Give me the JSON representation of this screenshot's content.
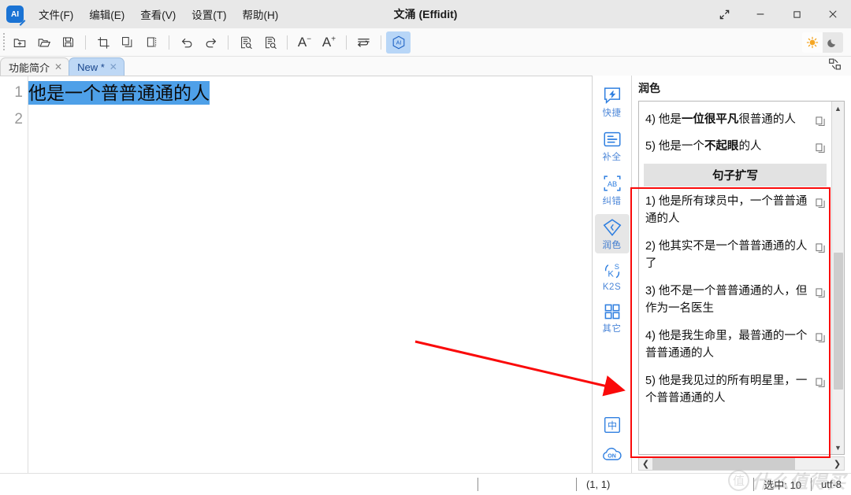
{
  "window": {
    "title": "文涌 (Effidit)",
    "logo_text": "AI",
    "controls": [
      {
        "name": "restore-expand-button",
        "glyph": "⤢"
      },
      {
        "name": "minimize-button",
        "glyph": "—"
      },
      {
        "name": "maximize-button",
        "glyph": "☐"
      },
      {
        "name": "close-button",
        "glyph": "✕"
      }
    ]
  },
  "menubar": {
    "items": [
      {
        "label": "文件(F)",
        "name": "menu-file"
      },
      {
        "label": "编辑(E)",
        "name": "menu-edit"
      },
      {
        "label": "查看(V)",
        "name": "menu-view"
      },
      {
        "label": "设置(T)",
        "name": "menu-settings"
      },
      {
        "label": "帮助(H)",
        "name": "menu-help"
      }
    ]
  },
  "toolbar": {
    "buttons": [
      {
        "name": "new-file-icon",
        "title": "新建"
      },
      {
        "name": "open-folder-icon",
        "title": "打开"
      },
      {
        "name": "save-icon",
        "title": "保存"
      },
      {
        "name": "cut-icon",
        "title": "剪切"
      },
      {
        "name": "copy-icon",
        "title": "复制"
      },
      {
        "name": "paste-icon",
        "title": "粘贴"
      },
      {
        "name": "undo-icon",
        "title": "撤销"
      },
      {
        "name": "redo-icon",
        "title": "重做"
      },
      {
        "name": "find-icon",
        "title": "查找"
      },
      {
        "name": "replace-icon",
        "title": "替换"
      },
      {
        "name": "font-decrease-icon",
        "label": "A−"
      },
      {
        "name": "font-increase-icon",
        "label": "A+"
      },
      {
        "name": "wrap-lines-icon",
        "title": "自动换行"
      },
      {
        "name": "ai-assistant-icon",
        "title": "AI",
        "active": true
      }
    ],
    "theme": {
      "light_icon": "sun-icon",
      "dark_icon": "moon-icon",
      "accent": "#f5a623"
    }
  },
  "tabs": {
    "items": [
      {
        "label": "功能简介",
        "close": "✕",
        "active": false,
        "name": "tab-intro"
      },
      {
        "label": "New *",
        "close": "✕",
        "active": true,
        "name": "tab-new"
      }
    ],
    "right_icon": "split-view-icon"
  },
  "editor": {
    "line_numbers": [
      "1",
      "2"
    ],
    "line1_text": "他是一个普普通通的人",
    "line2_text": ""
  },
  "rail": {
    "items": [
      {
        "label": "快捷",
        "name": "rail-item-shortcut",
        "icon": "lightning-bubble-icon",
        "active": false
      },
      {
        "label": "补全",
        "name": "rail-item-completion",
        "icon": "text-complete-icon",
        "active": false
      },
      {
        "label": "纠错",
        "name": "rail-item-correction",
        "icon": "spellcheck-icon",
        "active": false
      },
      {
        "label": "润色",
        "name": "rail-item-polish",
        "icon": "diamond-icon",
        "active": true
      },
      {
        "label": "K2S",
        "name": "rail-item-k2s",
        "icon": "keyword-to-sentence-icon",
        "active": false
      },
      {
        "label": "其它",
        "name": "rail-item-other",
        "icon": "grid-icon",
        "active": false
      }
    ],
    "bottom": [
      {
        "label": "中",
        "name": "language-toggle-icon"
      },
      {
        "label": "ON",
        "name": "cloud-on-icon"
      }
    ]
  },
  "panel": {
    "title": "润色",
    "top_suggestions": [
      {
        "num": "4)",
        "pre": " 他是",
        "bold": "一位很平凡",
        "post": "很普通的人"
      },
      {
        "num": "5)",
        "pre": " 他是一个",
        "bold": "不起眼",
        "post": "的人"
      }
    ],
    "section_header": "句子扩写",
    "expansion_suggestions": [
      {
        "num": "1)",
        "text": " 他是所有球员中，一个普普通通的人"
      },
      {
        "num": "2)",
        "text": " 他其实不是一个普普通通的人了"
      },
      {
        "num": "3)",
        "text": " 他不是一个普普通通的人，但作为一名医生"
      },
      {
        "num": "4)",
        "text": " 他是我生命里，最普通的一个普普通通的人"
      },
      {
        "num": "5)",
        "text": " 他是我见过的所有明星里，一个普普通通的人"
      }
    ],
    "copy_icon": "copy-icon",
    "scroll_up": "▲",
    "scroll_down": "▼",
    "scroll_left": "❮",
    "scroll_right": "❯"
  },
  "statusbar": {
    "cursor_position": "(1, 1)",
    "selection": "选中: 10",
    "encoding": "utf-8"
  },
  "annotations": {
    "highlight_color": "#fa0a0a",
    "arrow_from": "527,434",
    "arrow_to": "795,497"
  },
  "watermark": {
    "mark": "值",
    "text": "什么值得买"
  }
}
